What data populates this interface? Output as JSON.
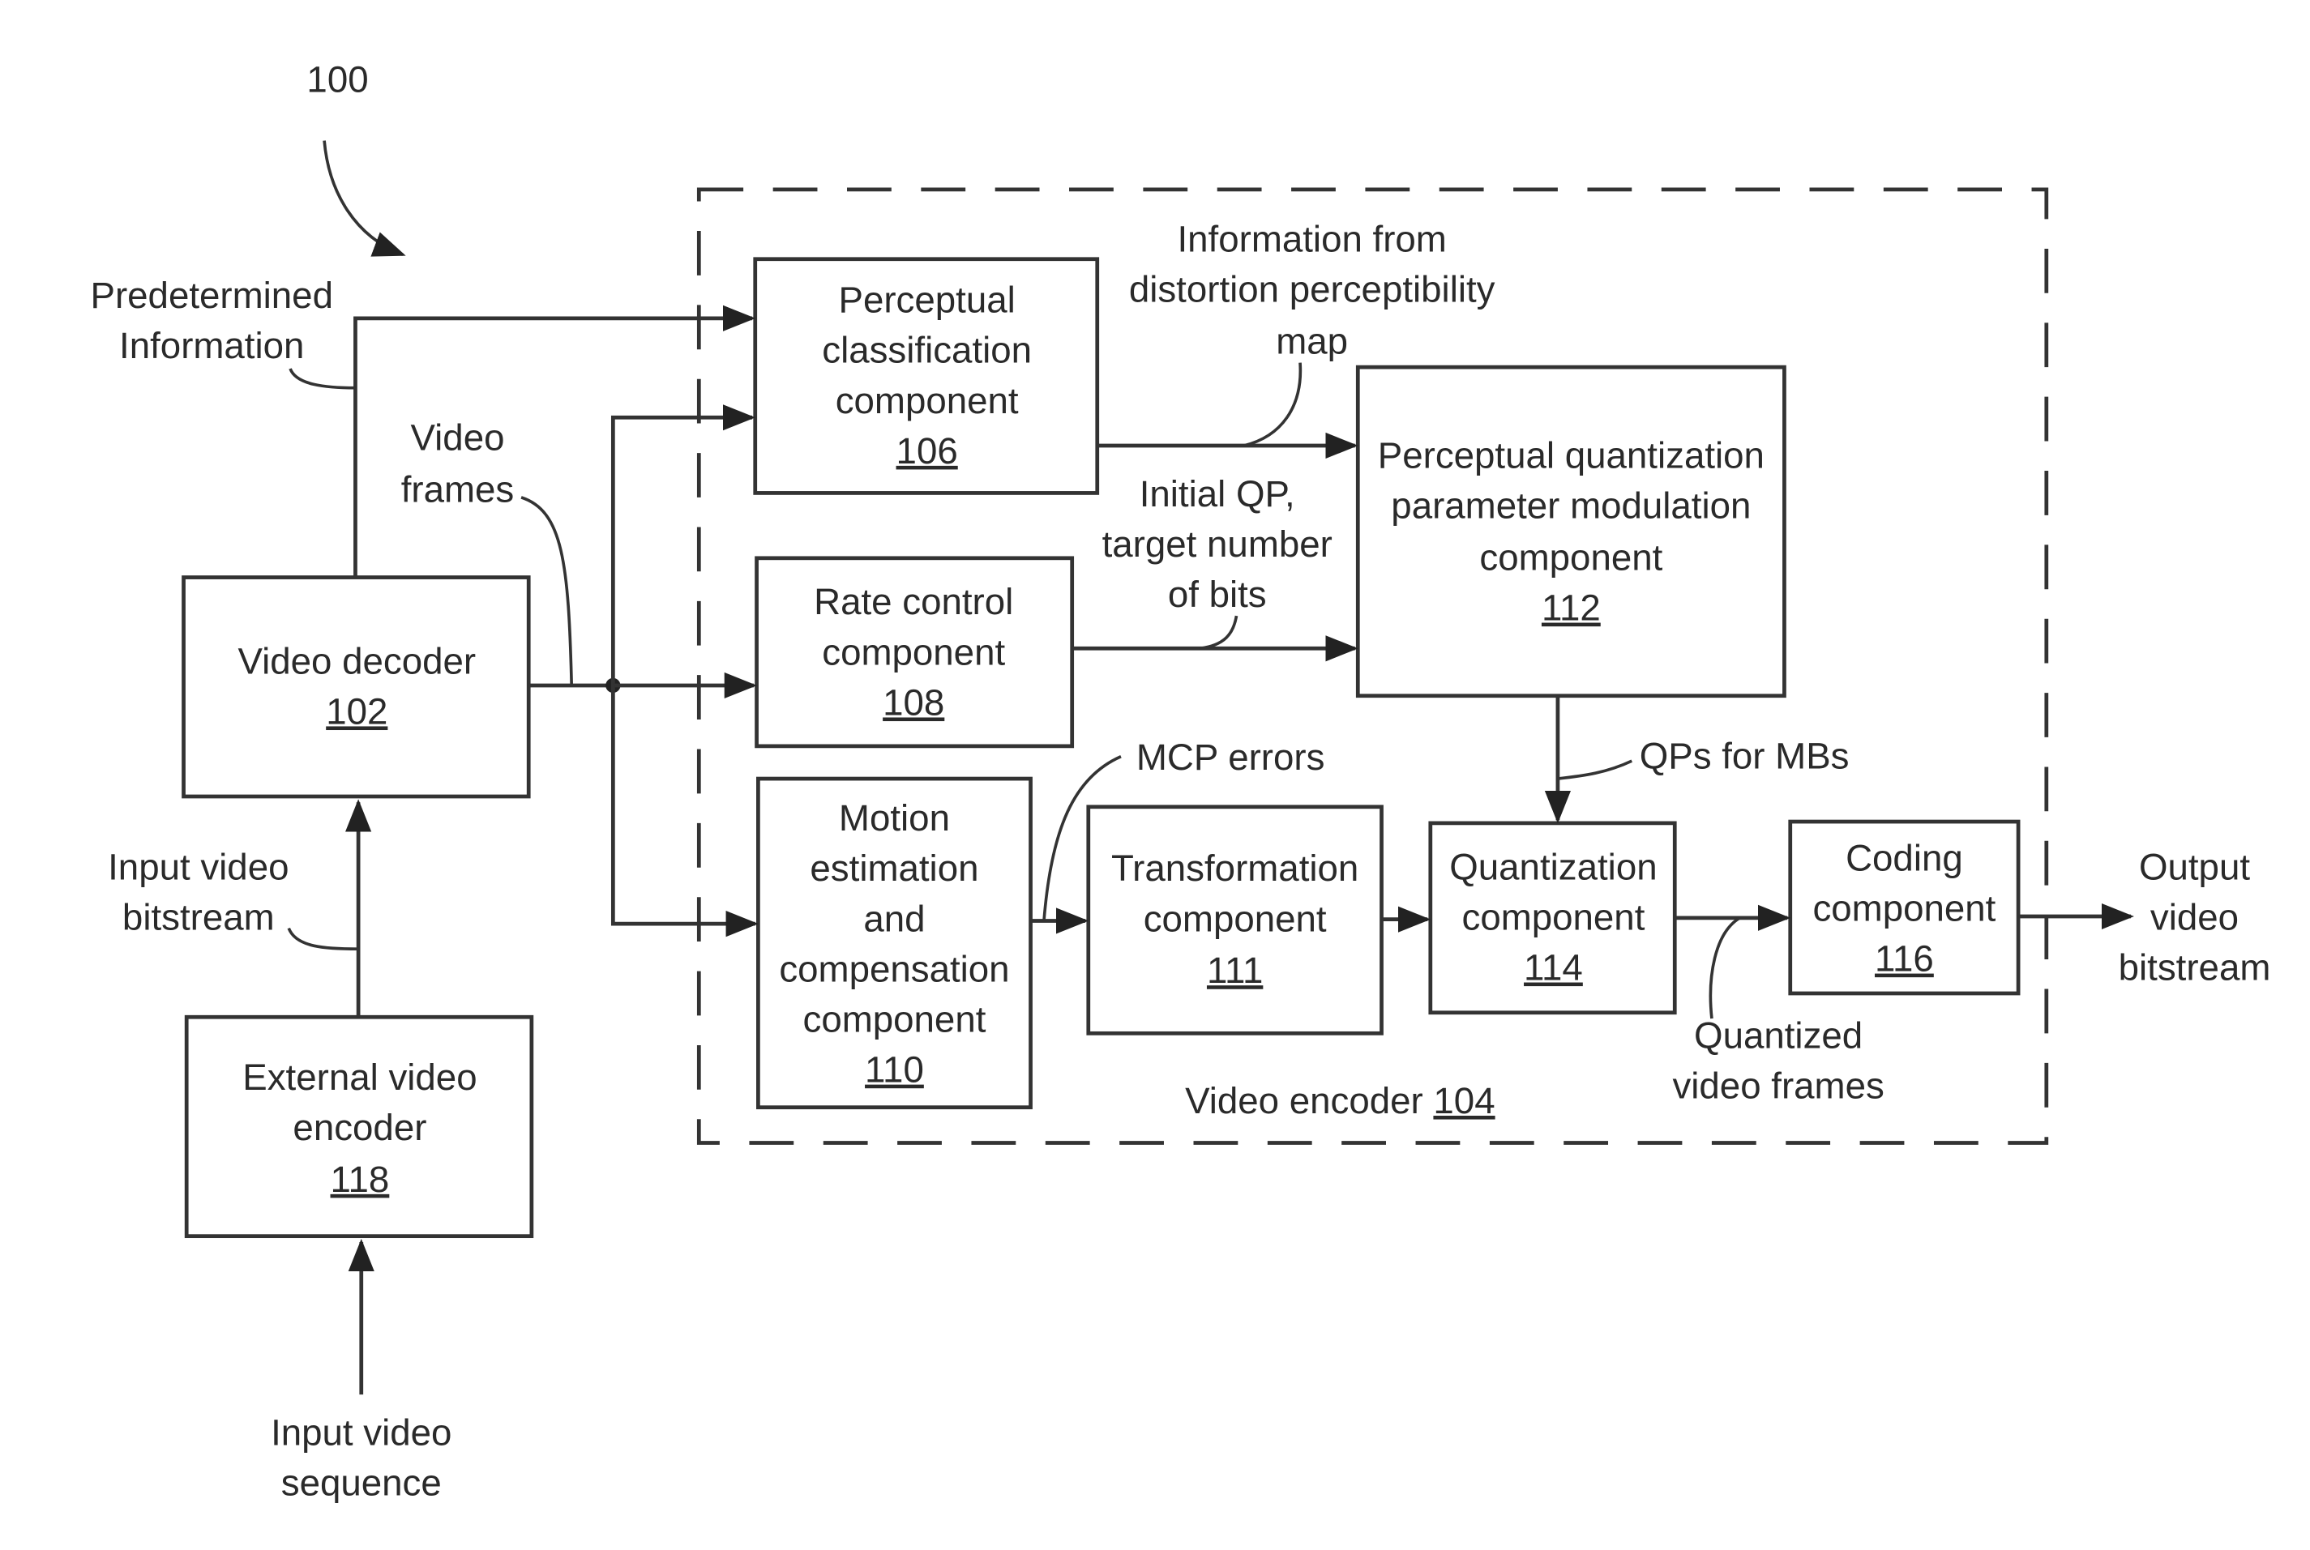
{
  "figure": {
    "reference": "100",
    "encoder_label": "Video encoder",
    "encoder_ref": "104"
  },
  "blocks": {
    "video_decoder": {
      "lines": [
        "Video decoder"
      ],
      "ref": "102"
    },
    "external_encoder": {
      "lines": [
        "External video",
        "encoder"
      ],
      "ref": "118"
    },
    "perceptual_classification": {
      "lines": [
        "Perceptual",
        "classification",
        "component"
      ],
      "ref": "106"
    },
    "rate_control": {
      "lines": [
        "Rate control",
        "component"
      ],
      "ref": "108"
    },
    "motion_estimation": {
      "lines": [
        "Motion",
        "estimation",
        "and",
        "compensation",
        "component"
      ],
      "ref": "110"
    },
    "transformation": {
      "lines": [
        "Transformation",
        "component"
      ],
      "ref": "111"
    },
    "pqp_modulation": {
      "lines": [
        "Perceptual quantization",
        "parameter modulation",
        "component"
      ],
      "ref": "112"
    },
    "quantization": {
      "lines": [
        "Quantization",
        "component"
      ],
      "ref": "114"
    },
    "coding": {
      "lines": [
        "Coding",
        "component"
      ],
      "ref": "116"
    }
  },
  "labels": {
    "predetermined_info": [
      "Predetermined",
      "Information"
    ],
    "video_frames": [
      "Video",
      "frames"
    ],
    "input_bitstream": [
      "Input video",
      "bitstream"
    ],
    "input_sequence": [
      "Input video",
      "sequence"
    ],
    "distortion_info": [
      "Information from",
      "distortion perceptibility",
      "map"
    ],
    "initial_qp": [
      "Initial QP,",
      "target number",
      "of bits"
    ],
    "qps_for_mbs": [
      "QPs for MBs"
    ],
    "mcp_errors": [
      "MCP errors"
    ],
    "quantized_frames": [
      "Quantized",
      "video frames"
    ],
    "output_bitstream": [
      "Output",
      "video",
      "bitstream"
    ]
  }
}
